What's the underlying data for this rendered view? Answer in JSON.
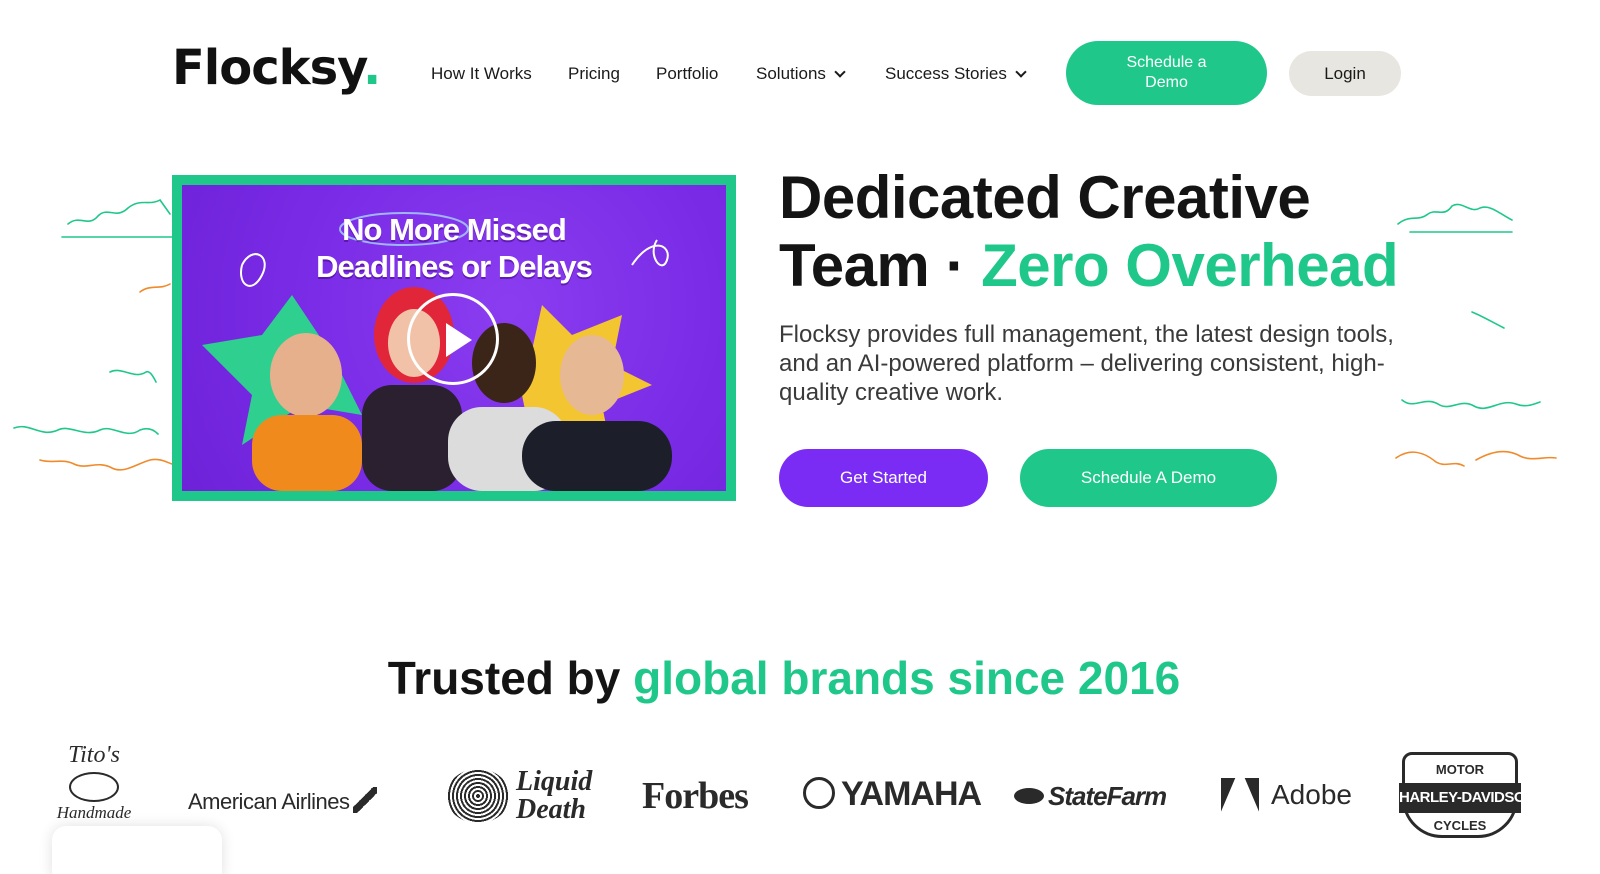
{
  "header": {
    "logo_text": "Flocksy",
    "logo_dot": ".",
    "nav": [
      {
        "label": "How It Works"
      },
      {
        "label": "Pricing"
      },
      {
        "label": "Portfolio"
      },
      {
        "label": "Solutions",
        "has_dropdown": true
      },
      {
        "label": "Success Stories",
        "has_dropdown": true
      }
    ],
    "schedule_demo_label": "Schedule a Demo",
    "login_label": "Login"
  },
  "hero": {
    "video": {
      "title_line1": "No More Missed",
      "title_line2": "Deadlines or Delays",
      "play_icon": "play-icon"
    },
    "title_line1": "Dedicated Creative",
    "title_line2_start": "Team · ",
    "title_line2_accent": "Zero Overhead",
    "description": "Flocksy provides full management, the latest design tools, and an AI-powered platform – delivering consistent, high-quality creative work.",
    "get_started_label": "Get Started",
    "schedule_demo_label": "Schedule A Demo"
  },
  "trusted": {
    "prefix": "Trusted by ",
    "accent": "global brands since 2016"
  },
  "brands": {
    "titos_top": "Tito's",
    "titos_bottom": "Handmade",
    "american_airlines": "American Airlines",
    "liquid_death": "Liquid Death",
    "forbes": "Forbes",
    "yamaha": "YAMAHA",
    "state_farm": "StateFarm",
    "adobe": "Adobe",
    "hd_top": "MOTOR",
    "hd_mid": "HARLEY-DAVIDSON",
    "hd_bottom": "CYCLES"
  },
  "colors": {
    "accent_green": "#1fc88a",
    "accent_purple": "#7a2cf5",
    "text_dark": "#141414"
  }
}
